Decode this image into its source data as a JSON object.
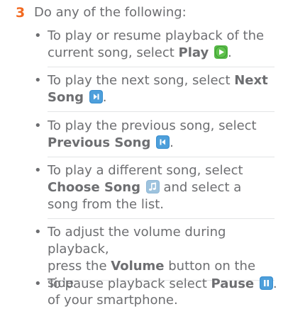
{
  "step": {
    "number": "3",
    "intro": "Do any of the following:"
  },
  "bullets": [
    {
      "lines": [
        "To play or resume playback of the",
        "current song, select "
      ],
      "bold": "Play",
      "icon": "play-icon",
      "after": "."
    },
    {
      "lines": [
        "To play the next song, select "
      ],
      "bold": "Next",
      "bold2": "Song",
      "icon": "next-song-icon",
      "after": "."
    },
    {
      "lines": [
        "To play the previous song, select"
      ],
      "bold": "Previous Song",
      "icon": "previous-song-icon",
      "after": "."
    },
    {
      "lines": [
        "To play a different song, select"
      ],
      "bold": "Choose Song",
      "icon": "choose-song-icon",
      "mid": " and select a",
      "tail": "song from the list."
    },
    {
      "lines": [
        "To adjust the volume during playback,",
        "press the "
      ],
      "bold": "Volume",
      "mid": " button on the side",
      "tail": "of your smartphone."
    },
    {
      "lines": [
        "To pause playback select "
      ],
      "bold": "Pause",
      "icon": "pause-icon",
      "after": "."
    }
  ],
  "colors": {
    "step_number": "#f26a21",
    "body_text": "#6d6e71",
    "icon_green": "#57b947",
    "icon_blue": "#3a8fd0",
    "icon_steel": "#8fb7d6"
  }
}
